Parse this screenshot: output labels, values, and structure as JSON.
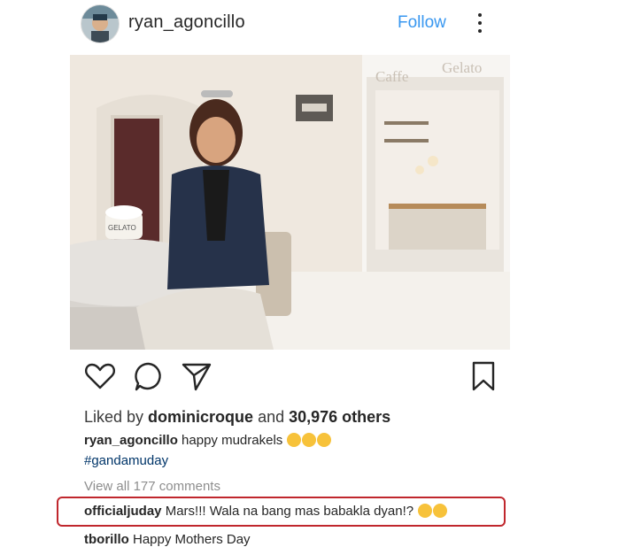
{
  "header": {
    "username": "ryan_agoncillo",
    "follow_label": "Follow"
  },
  "photo": {
    "sign_text_1": "Caffe",
    "sign_text_2": "Gelato",
    "cup_text": "GELATO"
  },
  "likes": {
    "prefix": "Liked by ",
    "user": "dominicroque",
    "middle": " and ",
    "count": "30,976 others"
  },
  "caption": {
    "user": "ryan_agoncillo",
    "text": " happy mudrakels",
    "hashtag": "#gandamuday"
  },
  "view_all": "View all 177 comments",
  "comments": [
    {
      "user": "officialjuday",
      "text": " Mars!!! Wala na bang mas babakla dyan!?"
    },
    {
      "user": "tborillo",
      "text": " Happy Mothers Day"
    }
  ],
  "colors": {
    "follow": "#3897f0",
    "highlight": "#c0272d",
    "hashtag": "#003569"
  }
}
